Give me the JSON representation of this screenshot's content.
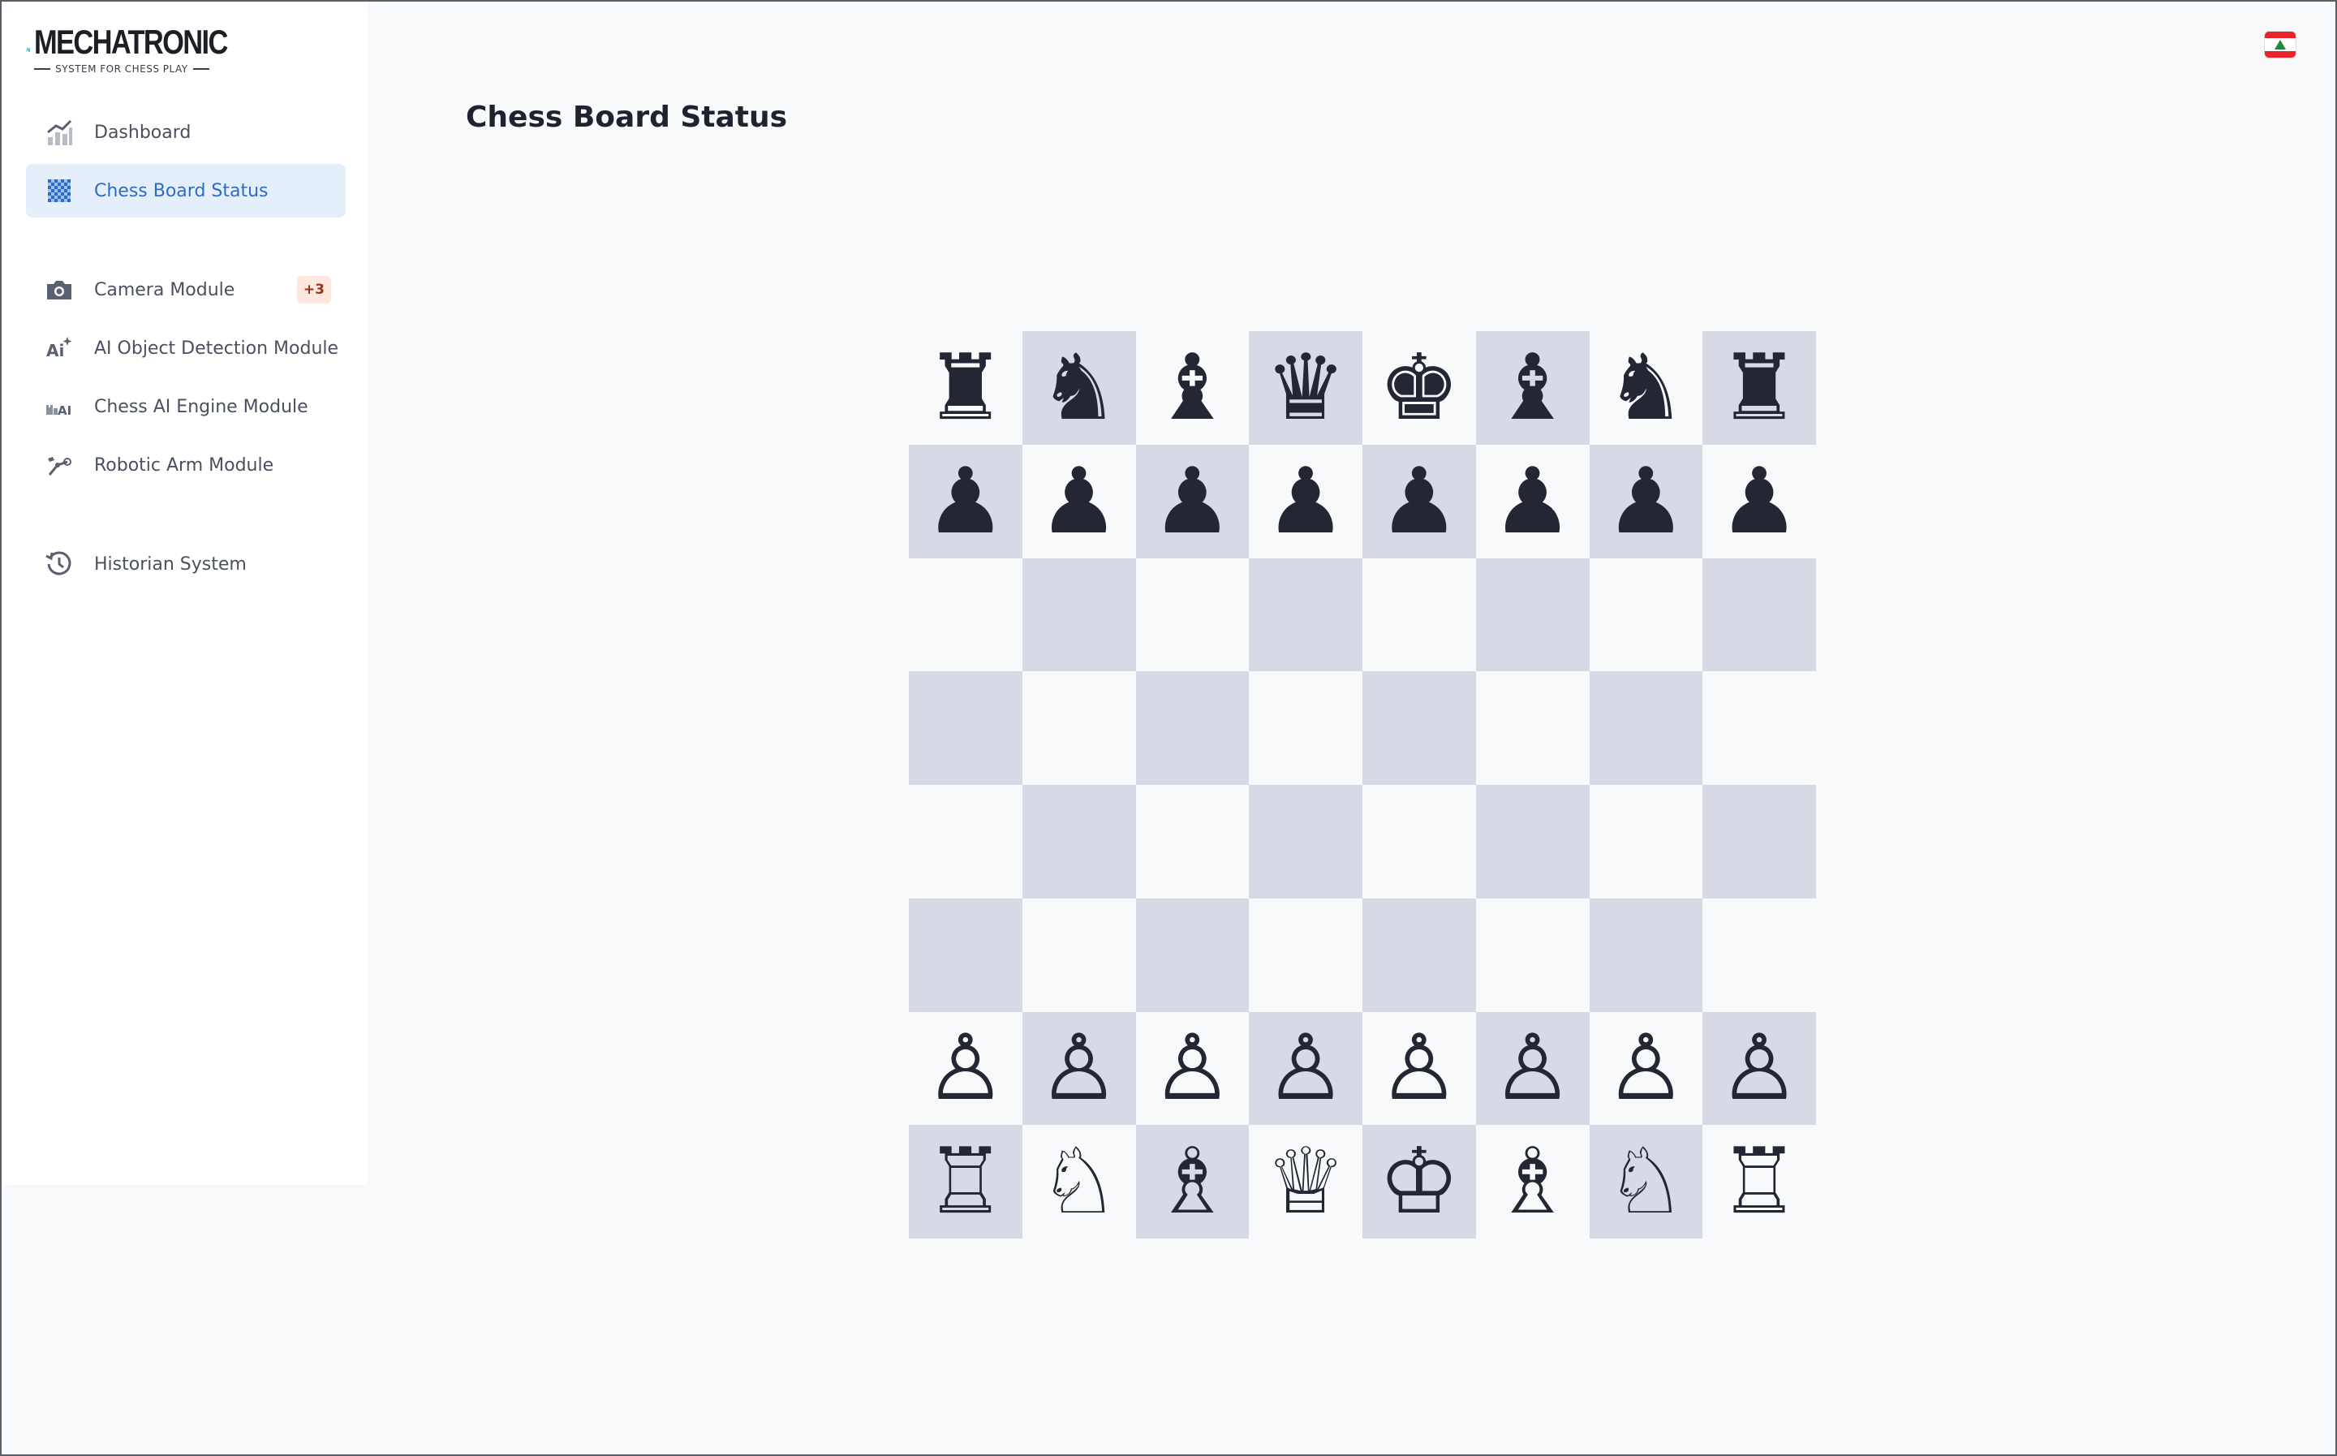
{
  "brand": {
    "name": "MECHATRONIC",
    "tagline": "SYSTEM FOR CHESS PLAY",
    "colors": {
      "primary": "#2ec4d6",
      "dark": "#1d1f26"
    }
  },
  "sidebar": {
    "items": [
      {
        "label": "Dashboard",
        "icon": "chart-icon",
        "active": false
      },
      {
        "label": "Chess Board Status",
        "icon": "checkerboard-icon",
        "active": true
      },
      {
        "label": "Camera Module",
        "icon": "camera-icon",
        "active": false,
        "badge": "+3"
      },
      {
        "label": "AI Object Detection Module",
        "icon": "ai-sparkle-icon",
        "active": false
      },
      {
        "label": "Chess AI Engine Module",
        "icon": "chess-ai-icon",
        "active": false
      },
      {
        "label": "Robotic Arm Module",
        "icon": "robotic-arm-icon",
        "active": false
      },
      {
        "label": "Historian System",
        "icon": "history-icon",
        "active": false
      }
    ]
  },
  "header": {
    "title": "Chess Board Status",
    "flag": "lebanon-flag-icon"
  },
  "board": {
    "rows": [
      [
        "♜",
        "♞",
        "♝",
        "♛",
        "♚",
        "♝",
        "♞",
        "♜"
      ],
      [
        "♟",
        "♟",
        "♟",
        "♟",
        "♟",
        "♟",
        "♟",
        "♟"
      ],
      [
        "",
        "",
        "",
        "",
        "",
        "",
        "",
        ""
      ],
      [
        "",
        "",
        "",
        "",
        "",
        "",
        "",
        ""
      ],
      [
        "",
        "",
        "",
        "",
        "",
        "",
        "",
        ""
      ],
      [
        "",
        "",
        "",
        "",
        "",
        "",
        "",
        ""
      ],
      [
        "♙",
        "♙",
        "♙",
        "♙",
        "♙",
        "♙",
        "♙",
        "♙"
      ],
      [
        "♖",
        "♘",
        "♗",
        "♕",
        "♔",
        "♗",
        "♘",
        "♖"
      ]
    ],
    "colors": {
      "light": "#f8f9fb",
      "dark": "#d7d9e4",
      "piece": "#242634"
    }
  }
}
